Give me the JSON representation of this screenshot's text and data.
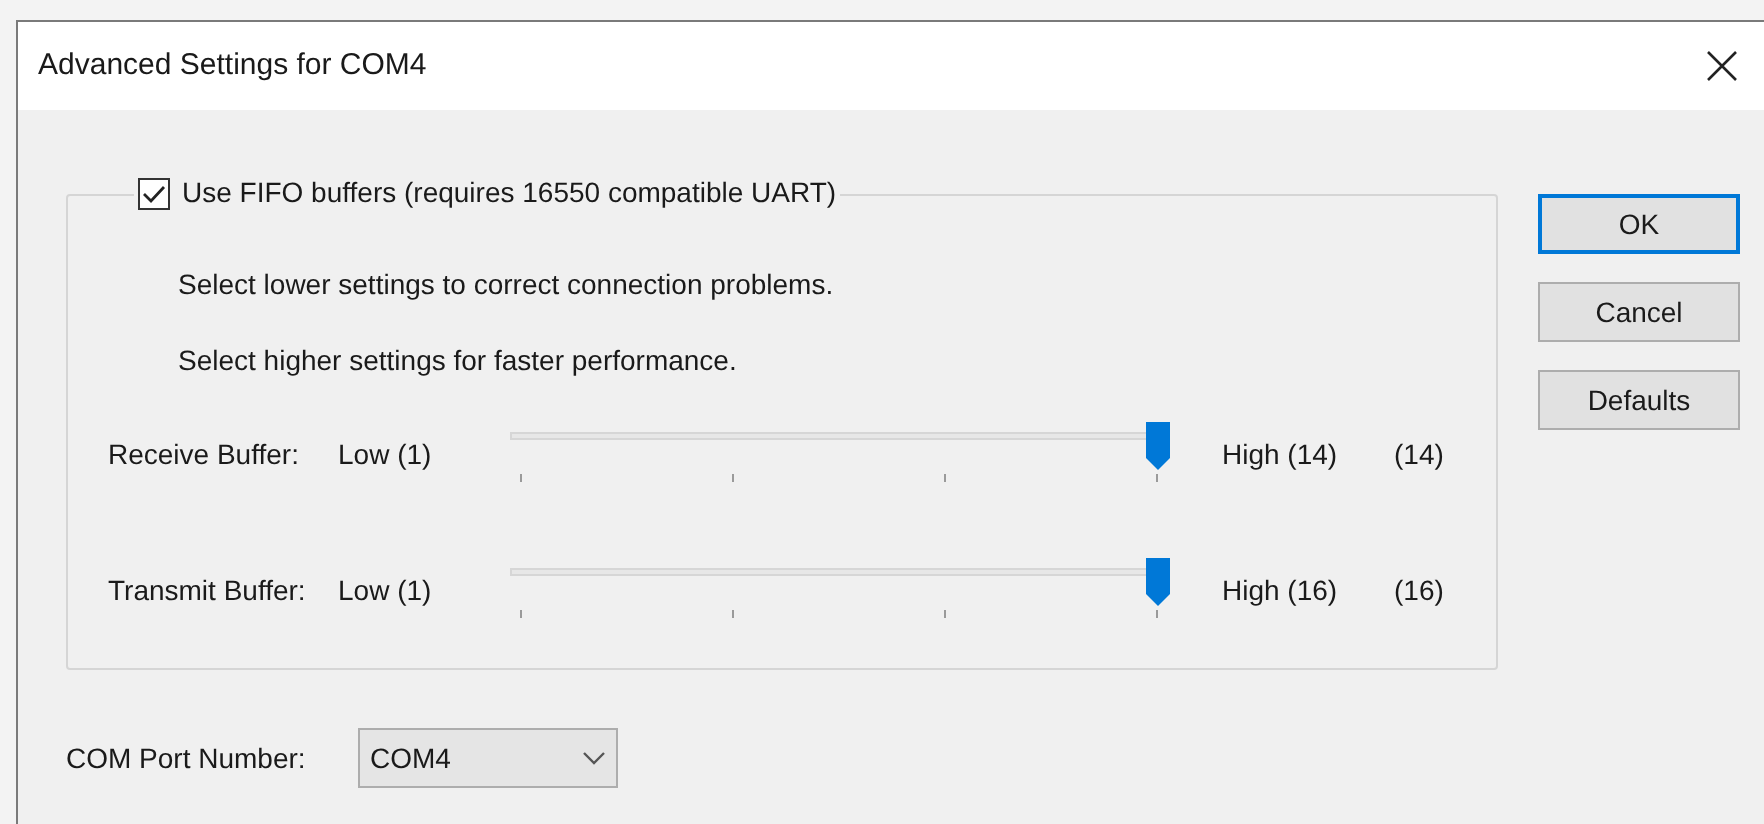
{
  "window": {
    "title": "Advanced Settings for COM4"
  },
  "fifo": {
    "label": "Use FIFO buffers (requires 16550 compatible UART)",
    "checked": true
  },
  "hints": [
    "Select lower settings to correct connection problems.",
    "Select higher settings for faster performance."
  ],
  "sliders": [
    {
      "label": "Receive Buffer:",
      "low": "Low (1)",
      "high": "High (14)",
      "reading": "(14)",
      "level": 1
    },
    {
      "label": "Transmit Buffer:",
      "low": "Low (1)",
      "high": "High (16)",
      "reading": "(16)",
      "level": 1
    }
  ],
  "buttons": [
    {
      "label": "OK",
      "default": true
    },
    {
      "label": "Cancel",
      "default": false
    },
    {
      "label": "Defaults",
      "default": false
    }
  ],
  "com_port": {
    "label": "COM Port Number:",
    "value": "COM4"
  }
}
